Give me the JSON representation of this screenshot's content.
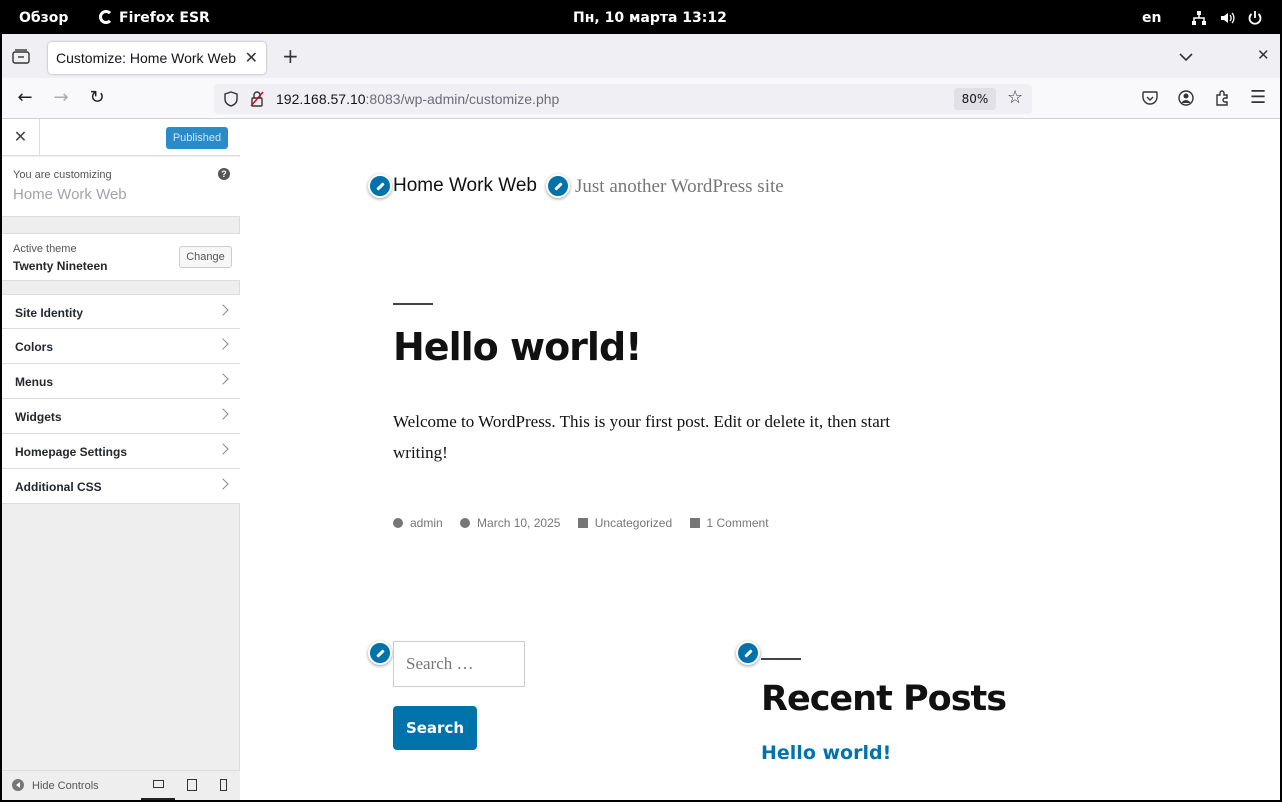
{
  "topbar": {
    "overview": "Обзор",
    "app": "Firefox ESR",
    "datetime": "Пн, 10 марта  13:12",
    "lang": "en"
  },
  "browser": {
    "tab_title": "Customize: Home Work Web",
    "url_host": "192.168.57.10",
    "url_rest": ":8083/wp-admin/customize.php",
    "zoom": "80%"
  },
  "customizer": {
    "published_label": "Published",
    "customizing_label": "You are customizing",
    "site_name": "Home Work Web",
    "active_theme_label": "Active theme",
    "theme_name": "Twenty Nineteen",
    "change_label": "Change",
    "sections": [
      {
        "label": "Site Identity"
      },
      {
        "label": "Colors"
      },
      {
        "label": "Menus"
      },
      {
        "label": "Widgets"
      },
      {
        "label": "Homepage Settings"
      },
      {
        "label": "Additional CSS"
      }
    ],
    "hide_controls": "Hide Controls"
  },
  "preview": {
    "site_title": "Home Work Web",
    "site_description": "Just another WordPress site",
    "post": {
      "title": "Hello world!",
      "body": "Welcome to WordPress. This is your first post. Edit or delete it, then start writing!",
      "author": "admin",
      "date": "March 10, 2025",
      "category": "Uncategorized",
      "comments": "1 Comment"
    },
    "search_placeholder": "Search …",
    "search_button": "Search",
    "recent_posts_title": "Recent Posts",
    "recent_post_link": "Hello world!"
  },
  "colors": {
    "accent": "#0073aa",
    "publish_button": "#2a8bc9"
  }
}
